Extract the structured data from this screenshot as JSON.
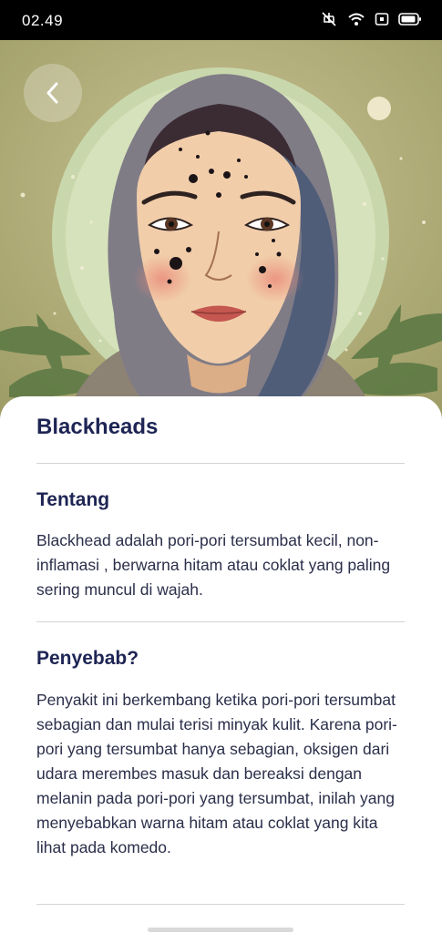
{
  "status_bar": {
    "time": "02.49",
    "icons": [
      "mute-icon",
      "wifi-icon",
      "sim-icon",
      "battery-icon"
    ]
  },
  "hero": {
    "image_subject": "cartoon-hijab-woman-with-blackheads",
    "back_icon": "chevron-left-icon"
  },
  "content": {
    "title": "Blackheads",
    "sections": [
      {
        "heading": "Tentang",
        "body": "Blackhead adalah pori-pori tersumbat kecil, non-inflamasi , berwarna hitam atau coklat yang paling sering muncul di wajah."
      },
      {
        "heading": "Penyebab?",
        "body": "Penyakit ini berkembang ketika pori-pori tersumbat sebagian dan mulai terisi minyak kulit. Karena pori-pori yang tersumbat hanya sebagian, oksigen dari udara merembes masuk dan bereaksi dengan melanin pada pori-pori yang tersumbat, inilah yang menyebabkan warna hitam atau coklat yang kita lihat pada komedo."
      }
    ]
  },
  "colors": {
    "heading": "#1e2554",
    "body_text": "#2b2f4a",
    "divider": "#d4d4d8",
    "hero_background": "#b7b27e"
  }
}
